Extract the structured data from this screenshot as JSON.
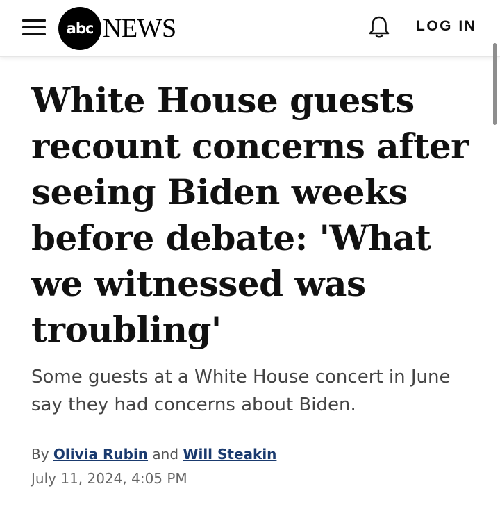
{
  "header": {
    "logo_mark": "abc",
    "logo_word": "NEWS",
    "login_label": "LOG IN",
    "icons": {
      "menu": "hamburger-menu-icon",
      "notifications": "bell-icon"
    }
  },
  "article": {
    "headline_lines": [
      "White House guests",
      "recount concerns after",
      "seeing Biden weeks",
      "before debate: 'What",
      "we witnessed was",
      "troubling'"
    ],
    "subhead_lines": [
      "Some guests at a White House concert in June",
      "say they had concerns about Biden."
    ],
    "byline": {
      "prefix": "By",
      "author1": "Olivia Rubin",
      "conjunction": "and",
      "author2": "Will Steakin"
    },
    "date": "July 11, 2024, 4:05 PM"
  },
  "colors": {
    "author_link": "#1a3a6e",
    "logo_bg": "#000000"
  }
}
